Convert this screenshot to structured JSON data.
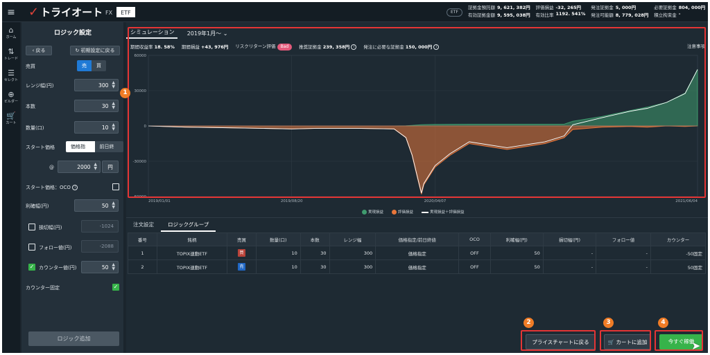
{
  "header": {
    "logo_text": "トライオート",
    "market_tabs": [
      {
        "label": "FX",
        "active": false
      },
      {
        "label": "ETF",
        "active": true
      }
    ],
    "badge": "ETF",
    "stats": [
      {
        "label": "証拠金預託額",
        "value": "9, 621, 382円"
      },
      {
        "label": "評価損益",
        "value": "-32, 265円"
      },
      {
        "label": "発注証拠金",
        "value": "5, 000円"
      },
      {
        "label": "必要証拠金",
        "value": "804, 000円"
      },
      {
        "label": "有効証拠金額",
        "value": "9, 595, 038円"
      },
      {
        "label": "有効比率",
        "value": "1192. 541%"
      },
      {
        "label": "発注可能額",
        "value": "8, 779, 028円"
      },
      {
        "label": "積立拘束金",
        "value": "-"
      }
    ]
  },
  "nav": [
    {
      "label": "ホーム",
      "icon": "home-icon",
      "glyph": "⌂"
    },
    {
      "label": "トレード",
      "icon": "trade-icon",
      "glyph": "⇅"
    },
    {
      "label": "セレクト",
      "icon": "select-icon",
      "glyph": "☰"
    },
    {
      "label": "ビルダー",
      "icon": "builder-icon",
      "glyph": "⊕"
    },
    {
      "label": "カート",
      "icon": "cart-icon",
      "glyph": "🛒"
    }
  ],
  "logic": {
    "title": "ロジック設定",
    "back_label": "戻る",
    "reset_label": "初期設定に戻る",
    "side_label": "売買",
    "side_options": [
      "売",
      "買"
    ],
    "range_label": "レンジ幅(円)",
    "range_value": "300",
    "count_label": "本数",
    "count_value": "30",
    "qty_label": "数量(口)",
    "qty_value": "10",
    "start_label": "スタート価格",
    "start_options": [
      "価格指定",
      "前日終値"
    ],
    "at_label": "@",
    "start_value": "2000",
    "start_unit": "円",
    "oco_label": "スタート価格：OCO",
    "tp_label": "利確幅(円)",
    "tp_value": "50",
    "sl_label": "損切幅(円)",
    "sl_value": "-1024",
    "follow_label": "フォロー値(円)",
    "follow_value": "-2088",
    "counter_label": "カウンター値(円)",
    "counter_value": "50",
    "counter_fixed_label": "カウンター固定",
    "add_label": "ロジック追加"
  },
  "sim": {
    "tab_label": "シミュレーション",
    "period": "2019年1月〜",
    "return_label": "期間収益率",
    "return_value": "18. 58%",
    "pl_label": "期間損益",
    "pl_value": "+43, 976円",
    "risk_label": "リスクリターン評価",
    "risk_value": "Bad",
    "recmargin_label": "推奨証拠金",
    "recmargin_value": "239, 358円",
    "ordermargin_label": "発注に必要な証拠金",
    "ordermargin_value": "150, 000円",
    "notes_label": "注意事項"
  },
  "chart_data": {
    "type": "area",
    "x": [
      "2019/01/01",
      "2019/03/01",
      "2019/05/01",
      "2019/07/01",
      "2019/08/20",
      "2019/10/01",
      "2019/12/01",
      "2020/02/01",
      "2020/02/20",
      "2020/03/01",
      "2020/03/10",
      "2020/03/16",
      "2020/03/20",
      "2020/04/07",
      "2020/05/01",
      "2020/06/01",
      "2020/08/01",
      "2020/10/01",
      "2020/11/01",
      "2020/11/15",
      "2021/01/01",
      "2021/02/15",
      "2021/03/15",
      "2021/04/15",
      "2021/05/15",
      "2021/06/04"
    ],
    "series": [
      {
        "name": "実現損益",
        "color": "#3f9a6e",
        "values": [
          0,
          0,
          0,
          0,
          0,
          0,
          0,
          0,
          200,
          500,
          800,
          1000,
          1100,
          1300,
          1400,
          1500,
          1500,
          1500,
          1500,
          4000,
          8000,
          13000,
          16000,
          20000,
          28000,
          48000
        ]
      },
      {
        "name": "評価損益",
        "color": "#e8763a",
        "values": [
          0,
          -1000,
          -1500,
          -2000,
          -2500,
          -2000,
          -2000,
          -2500,
          -10000,
          -25000,
          -45000,
          -58000,
          -50000,
          -35000,
          -25000,
          -15000,
          -20000,
          -15000,
          -10000,
          -3000,
          -1000,
          -500,
          -1000,
          0,
          -500,
          0
        ]
      },
      {
        "name": "実現損益＋評価損益",
        "color": "#ffffff",
        "values": [
          0,
          -1000,
          -1500,
          -2000,
          -2500,
          -2000,
          -2000,
          -2500,
          -9800,
          -24500,
          -44200,
          -57000,
          -48900,
          -33700,
          -23600,
          -13500,
          -18500,
          -13500,
          -8500,
          1000,
          7000,
          12500,
          15000,
          20000,
          27500,
          48000
        ]
      }
    ],
    "yticks": [
      "60000",
      "30000",
      "0",
      "-30000",
      "-60000"
    ],
    "xticks": [
      "2019/01/01",
      "2019/08/20",
      "2020/04/07",
      "2021/06/04"
    ],
    "ylim": [
      -60000,
      60000
    ]
  },
  "bottom_tabs": [
    {
      "label": "注文設定",
      "active": false
    },
    {
      "label": "ロジックグループ",
      "active": true
    }
  ],
  "table": {
    "headers": [
      "番号",
      "銘柄",
      "売買",
      "数量(口)",
      "本数",
      "レンジ幅",
      "価格指定/前日終値",
      "OCO",
      "利確幅(円)",
      "損切幅(円)",
      "フォロー値",
      "カウンター"
    ],
    "rows": [
      {
        "no": "1",
        "symbol": "TOPIX連動ETF",
        "side": "買",
        "qty": "10",
        "count": "30",
        "range": "300",
        "price": "価格指定",
        "oco": "OFF",
        "tp": "50",
        "sl": "-",
        "follow": "-",
        "counter": "-50固定"
      },
      {
        "no": "2",
        "symbol": "TOPIX連動ETF",
        "side": "売",
        "qty": "10",
        "count": "30",
        "range": "300",
        "price": "価格指定",
        "oco": "OFF",
        "tp": "50",
        "sl": "-",
        "follow": "-",
        "counter": "50固定"
      }
    ]
  },
  "buttons": {
    "price_chart": "プライスチャートに戻る",
    "add_cart": "カートに追加",
    "order_now": "今すぐ稼働"
  },
  "markers": [
    "1",
    "2",
    "3",
    "4"
  ],
  "colors": {
    "buy": "#b8433a",
    "sell": "#2067c4",
    "accent": "#1f7ad6",
    "order": "#37b34a",
    "highlight": "#e53535",
    "marker": "#f07c26"
  }
}
